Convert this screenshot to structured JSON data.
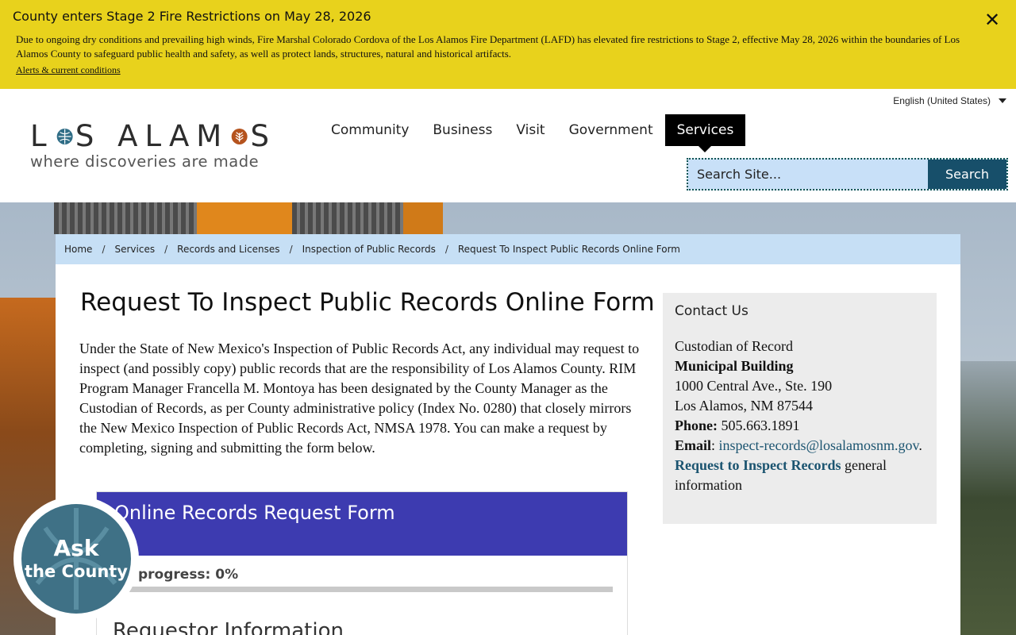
{
  "alert": {
    "title": "County enters Stage 2 Fire Restrictions on May 28, 2026",
    "body": "Due to ongoing dry conditions and prevailing high winds, Fire Marshal Colorado Cordova of the Los Alamos Fire Department (LAFD) has elevated fire restrictions to Stage 2, effective May 28, 2026 within the boundaries of Los Alamos County to safeguard public health and safety, as well as protect lands, structures, natural and historical artifacts.",
    "link": "Alerts & current conditions",
    "close": "✕"
  },
  "header": {
    "language": "English (United States)",
    "logo": {
      "part1": "L",
      "part2": "S ALAM",
      "part3": "S",
      "tagline": "where discoveries are made"
    },
    "nav": [
      "Community",
      "Business",
      "Visit",
      "Government",
      "Services"
    ],
    "active_nav": "Services",
    "search": {
      "placeholder": "Search Site...",
      "button": "Search"
    }
  },
  "breadcrumb": [
    "Home",
    "Services",
    "Records and Licenses",
    "Inspection of Public Records",
    "Request To Inspect Public Records Online Form"
  ],
  "breadcrumb_separator": "/",
  "page": {
    "title": "Request To Inspect Public Records Online Form",
    "intro": "Under the State of New Mexico's Inspection of Public Records Act, any individual may request to inspect (and possibly copy) public records that are the responsibility of Los Alamos County. RIM Program Manager Francella M. Montoya has been designated by the County Manager as the Custodian of Records, as per County administrative policy (Index No. 0280) that closely mirrors the New Mexico Inspection of Public Records Act, NMSA 1978.  You can make a request by completing, signing and submitting the form below."
  },
  "form": {
    "title": "Online Records Request Form",
    "progress_label": "progress: 0%",
    "progress": 0,
    "section": "Requestor Information"
  },
  "contact": {
    "heading": "Contact Us",
    "custodian": "Custodian of Record",
    "building": "Municipal Building",
    "address1": "1000 Central Ave., Ste. 190",
    "address2": "Los Alamos, NM 87544",
    "phone_label": "Phone:",
    "phone": "505.663.1891",
    "email_label": "Email",
    "email": "inspect-records@losalamosnm.gov",
    "request_link": "Request to Inspect Records",
    "request_suffix": "general information"
  },
  "ask": {
    "line1": "Ask",
    "line2": "the County"
  },
  "colors": {
    "alert_bg": "#e8d21c",
    "nav_active": "#000000",
    "search_button": "#174f6a",
    "breadcrumb_bg": "#c6dff5",
    "form_header": "#3d3bb0",
    "ask_badge": "#3f7186",
    "logo_globe": "#2f6d86",
    "logo_leaf": "#b5531e"
  }
}
